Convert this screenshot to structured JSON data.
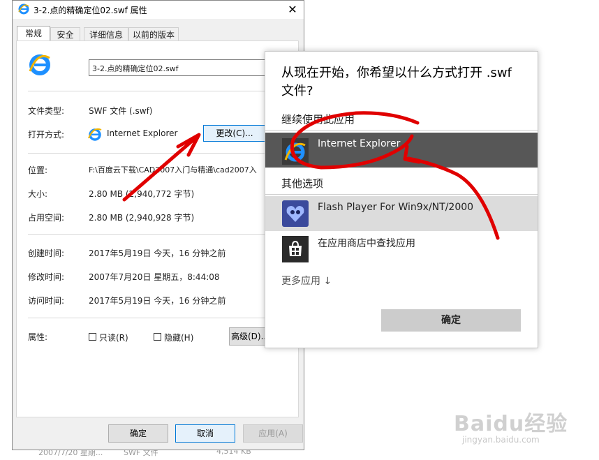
{
  "background_row": {
    "date": "2007/7/20 星期...",
    "type": "SWF 文件",
    "size": "4,514 KB"
  },
  "props": {
    "title": "3-2.点的精确定位02.swf 属性",
    "tabs": [
      {
        "label": "常规",
        "active": true
      },
      {
        "label": "安全",
        "active": false
      },
      {
        "label": "详细信息",
        "active": false
      },
      {
        "label": "以前的版本",
        "active": false
      }
    ],
    "file_name": "3-2.点的精确定位02.swf",
    "rows": {
      "file_type_label": "文件类型:",
      "file_type_value": "SWF 文件 (.swf)",
      "open_with_label": "打开方式:",
      "open_with_value": "Internet Explorer",
      "change_button": "更改(C)...",
      "location_label": "位置:",
      "location_value": "F:\\百度云下载\\CAD2007入门与精通\\cad2007入",
      "size_label": "大小:",
      "size_value": "2.80 MB (2,940,772 字节)",
      "disk_label": "占用空间:",
      "disk_value": "2.80 MB (2,940,928 字节)",
      "created_label": "创建时间:",
      "created_value": "2017年5月19日 今天，16 分钟之前",
      "modified_label": "修改时间:",
      "modified_value": "2007年7月20日 星期五，8:44:08",
      "accessed_label": "访问时间:",
      "accessed_value": "2017年5月19日 今天，16 分钟之前",
      "attributes_label": "属性:",
      "readonly_label": "只读(R)",
      "hidden_label": "隐藏(H)",
      "advanced_button": "高级(D)..."
    },
    "buttons": {
      "ok": "确定",
      "cancel": "取消",
      "apply": "应用(A)"
    }
  },
  "openwith": {
    "question": "从现在开始，你希望以什么方式打开 .swf 文件?",
    "keep_heading": "继续使用此应用",
    "current_app": "Internet Explorer",
    "other_heading": "其他选项",
    "apps": [
      "Flash Player For Win9x/NT/2000",
      "在应用商店中查找应用"
    ],
    "more_apps": "更多应用 ↓",
    "confirm": "确定"
  },
  "watermark": {
    "logo": "Baidu经验",
    "url": "jingyan.baidu.com"
  },
  "colors": {
    "accent": "#0078d7",
    "ie_blue": "#1e90ff",
    "ie_ring": "#f0b400",
    "highlight": "#575757",
    "annotation_red": "#e00000"
  },
  "icons": [
    "ie-icon",
    "close-icon",
    "flash-player-icon",
    "store-icon",
    "chevron-down-icon"
  ]
}
